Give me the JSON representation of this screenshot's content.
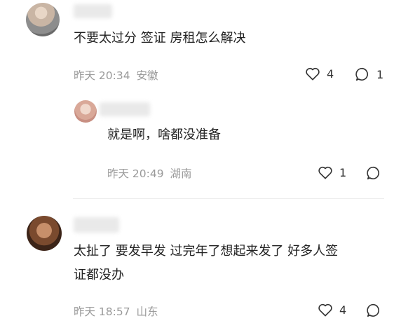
{
  "comments": [
    {
      "text": "不要太过分 签证 房租怎么解决",
      "time": "昨天 20:34",
      "location": "安徽",
      "likes": "4",
      "replies": "1"
    },
    {
      "text": "就是啊，啥都没准备",
      "time": "昨天 20:49",
      "location": "湖南",
      "likes": "1",
      "replies": ""
    },
    {
      "text_line1": "太扯了 要发早发 过完年了想起来发了 好多人签",
      "text_line2": "证都没办",
      "time": "昨天 18:57",
      "location": "山东",
      "likes": "4",
      "replies": ""
    }
  ],
  "icons": {
    "like": "heart-outline-icon",
    "reply": "speech-bubble-icon"
  },
  "colors": {
    "text": "#222222",
    "meta": "#9a9a9a",
    "icon": "#333333"
  }
}
